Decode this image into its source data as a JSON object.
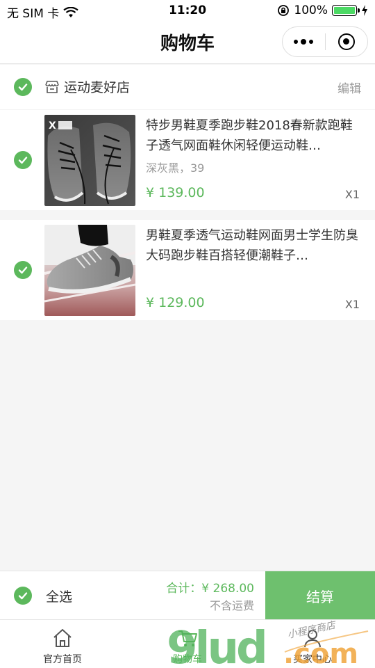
{
  "status_bar": {
    "carrier": "无 SIM 卡",
    "time": "11:20",
    "battery": "100%"
  },
  "nav": {
    "title": "购物车"
  },
  "shop": {
    "name": "运动麦好店",
    "edit_label": "编辑"
  },
  "items": [
    {
      "title": "特步男鞋夏季跑步鞋2018春新款跑鞋子透气网面鞋休闲轻便运动鞋…",
      "spec": "深灰黑，39",
      "price": "¥ 139.00",
      "qty": "X1",
      "checked": true
    },
    {
      "title": "男鞋夏季透气运动鞋网面男士学生防臭大码跑步鞋百搭轻便潮鞋子…",
      "spec": "",
      "price": "¥ 129.00",
      "qty": "X1",
      "checked": true
    }
  ],
  "summary": {
    "select_all_label": "全选",
    "total": "合计：¥ 268.00",
    "shipping_note": "不含运费",
    "checkout_label": "结算"
  },
  "tabs": [
    {
      "label": "官方首页",
      "icon": "home-icon",
      "active": false
    },
    {
      "label": "购物车",
      "icon": "cart-icon",
      "active": true
    },
    {
      "label": "买家中心",
      "icon": "user-icon",
      "active": false
    }
  ],
  "watermark": {
    "text": "9lud.com",
    "subtext": "小程序商店"
  },
  "colors": {
    "accent": "#5cb85c",
    "checkout": "#6ec06e",
    "background": "#f5f5f5"
  }
}
